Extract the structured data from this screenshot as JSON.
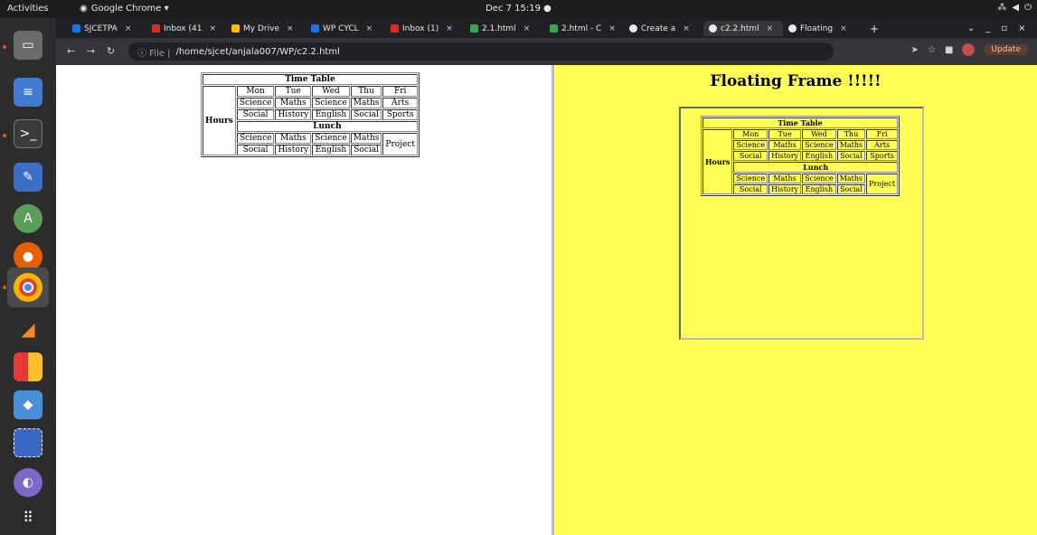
{
  "topbar": {
    "activities": "Activities",
    "app_name": "Google Chrome ▾",
    "clock": "Dec 7  15:19  ●"
  },
  "tabs": [
    {
      "label": "SJCETPA",
      "color": "#1a73e8"
    },
    {
      "label": "Inbox (41",
      "color": "#d93025"
    },
    {
      "label": "My Drive",
      "color": "#fbbc04"
    },
    {
      "label": "WP CYCL",
      "color": "#1a73e8"
    },
    {
      "label": "Inbox (1)",
      "color": "#d93025"
    },
    {
      "label": "2.1.html",
      "color": "#34a853"
    },
    {
      "label": "2.html - C",
      "color": "#34a853"
    },
    {
      "label": "Create a",
      "color": "#e8eaed"
    },
    {
      "label": "c2.2.html",
      "color": "#e8eaed"
    },
    {
      "label": "Floating",
      "color": "#e8eaed"
    }
  ],
  "toolbar": {
    "scheme": "ⓘ File |",
    "path": "/home/sjcet/anjala007/WP/c2.2.html",
    "update": "Update"
  },
  "timetable": {
    "title": "Time Table",
    "days": [
      "Mon",
      "Tue",
      "Wed",
      "Thu",
      "Fri"
    ],
    "row_header": "Hours",
    "row1": [
      "Science",
      "Maths",
      "Science",
      "Maths",
      "Arts"
    ],
    "row2": [
      "Social",
      "History",
      "English",
      "Social",
      "Sports"
    ],
    "lunch": "Lunch",
    "row3": [
      "Science",
      "Maths",
      "Science",
      "Maths"
    ],
    "row4": [
      "Social",
      "History",
      "English",
      "Social"
    ],
    "project": "Project"
  },
  "right_frame": {
    "heading": "Floating Frame !!!!!"
  },
  "colors": {
    "right_pane_bg": "#ffff55",
    "dock_bg": "#2c2c2c",
    "topbar_bg": "#1d1d1d"
  }
}
